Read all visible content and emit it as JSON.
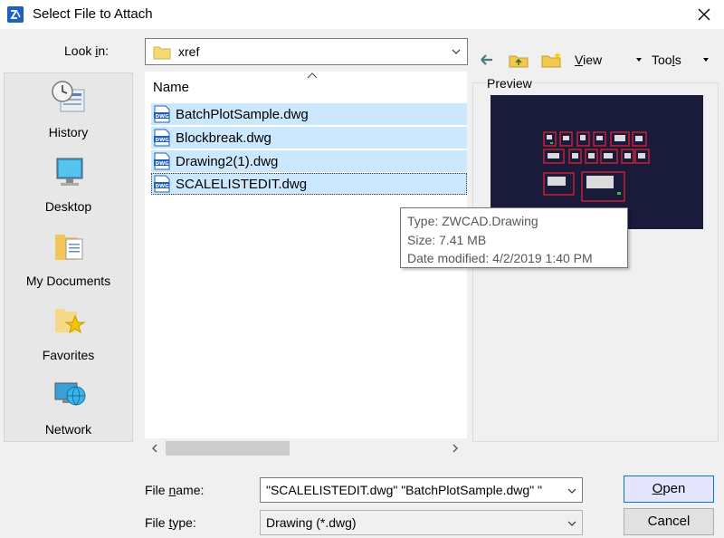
{
  "window": {
    "title": "Select File to Attach"
  },
  "lookin": {
    "label_pre": "Look ",
    "label_u": "i",
    "label_post": "n:",
    "value": "xref"
  },
  "toolbar": {
    "view_label_u": "V",
    "view_label_rest": "iew",
    "tools_label_pre": "Too",
    "tools_label_u": "l",
    "tools_label_post": "s"
  },
  "places": [
    {
      "label": "History",
      "icon": "history-icon"
    },
    {
      "label": "Desktop",
      "icon": "desktop-icon"
    },
    {
      "label": "My Documents",
      "icon": "documents-icon"
    },
    {
      "label": "Favorites",
      "icon": "favorites-icon"
    },
    {
      "label": "Network",
      "icon": "network-icon"
    }
  ],
  "filelist": {
    "column_header": "Name",
    "files": [
      {
        "name": "BatchPlotSample.dwg"
      },
      {
        "name": "Blockbreak.dwg"
      },
      {
        "name": "Drawing2(1).dwg"
      },
      {
        "name": "SCALELISTEDIT.dwg"
      }
    ]
  },
  "preview": {
    "label": "Preview"
  },
  "tooltip": {
    "type": "Type: ZWCAD.Drawing",
    "size": "Size: 7.41 MB",
    "modified": "Date modified: 4/2/2019 1:40 PM"
  },
  "filename": {
    "label_pre": "File ",
    "label_u": "n",
    "label_post": "ame:",
    "value": "\"SCALELISTEDIT.dwg\" \"BatchPlotSample.dwg\" \""
  },
  "filetype": {
    "label_pre": "File ",
    "label_u": "t",
    "label_post": "ype:",
    "value": "Drawing (*.dwg)"
  },
  "buttons": {
    "open_u": "O",
    "open_rest": "pen",
    "cancel": "Cancel"
  },
  "colors": {
    "selection": "#cce8ff",
    "preview_bg": "#1a1a3a",
    "accent": "#0078d7"
  }
}
